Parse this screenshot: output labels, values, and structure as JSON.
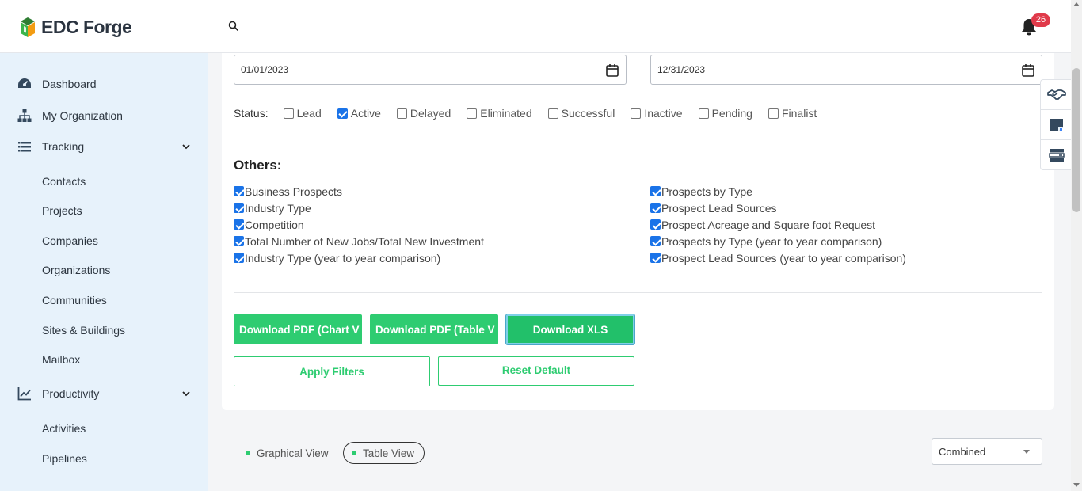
{
  "app": {
    "name": "EDC Forge",
    "notification_count": "26"
  },
  "header": {
    "search_icon": "search-icon",
    "bell_icon": "bell-icon"
  },
  "sidebar": {
    "items": [
      {
        "label": "Dashboard",
        "icon": "dashboard-gauge-icon"
      },
      {
        "label": "My Organization",
        "icon": "org-chart-icon"
      },
      {
        "label": "Tracking",
        "icon": "list-icon",
        "expanded": true,
        "children": [
          "Contacts",
          "Projects",
          "Companies",
          "Organizations",
          "Communities",
          "Sites & Buildings",
          "Mailbox"
        ]
      },
      {
        "label": "Productivity",
        "icon": "line-chart-icon",
        "expanded": true,
        "children": [
          "Activities",
          "Pipelines"
        ]
      }
    ]
  },
  "filters": {
    "start_date": "01/01/2023",
    "end_date": "12/31/2023",
    "status_label": "Status:",
    "statuses": [
      {
        "label": "Lead",
        "checked": false
      },
      {
        "label": "Active",
        "checked": true
      },
      {
        "label": "Delayed",
        "checked": false
      },
      {
        "label": "Eliminated",
        "checked": false
      },
      {
        "label": "Successful",
        "checked": false
      },
      {
        "label": "Inactive",
        "checked": false
      },
      {
        "label": "Pending",
        "checked": false
      },
      {
        "label": "Finalist",
        "checked": false
      }
    ],
    "others_title": "Others:",
    "others_left": [
      {
        "label": "Business Prospects",
        "checked": true
      },
      {
        "label": "Industry Type",
        "checked": true
      },
      {
        "label": "Competition",
        "checked": true
      },
      {
        "label": "Total Number of New Jobs/Total New Investment",
        "checked": true
      },
      {
        "label": "Industry Type (year to year comparison)",
        "checked": true
      }
    ],
    "others_right": [
      {
        "label": "Prospects by Type",
        "checked": true
      },
      {
        "label": "Prospect Lead Sources",
        "checked": true
      },
      {
        "label": "Prospect Acreage and Square foot Request",
        "checked": true
      },
      {
        "label": "Prospects by Type (year to year comparison)",
        "checked": true
      },
      {
        "label": "Prospect Lead Sources (year to year comparison)",
        "checked": true
      }
    ]
  },
  "actions": {
    "download_pdf_chart": "Download PDF (Chart V",
    "download_pdf_table": "Download PDF (Table V",
    "download_xls": "Download XLS",
    "apply_filters": "Apply Filters",
    "reset_default": "Reset Default"
  },
  "views": {
    "graphical": "Graphical View",
    "table": "Table View",
    "selected": "Table View",
    "mode_select": "Combined"
  },
  "colors": {
    "accent_green": "#2ecc71",
    "sidebar_bg": "#e7f2fb",
    "badge_red": "#e03a4a"
  }
}
